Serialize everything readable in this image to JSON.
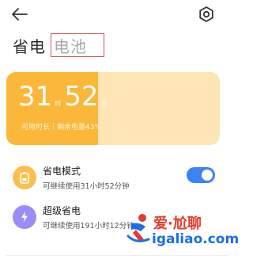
{
  "header": {
    "back_icon": "arrow-left-icon",
    "settings_icon": "gear-icon"
  },
  "title": {
    "page": "省电",
    "tab": "电池"
  },
  "battery": {
    "hours": "31",
    "hours_unit": "时",
    "minutes": "52",
    "minutes_unit": "分",
    "subtitle": "可用时长｜剩余电量43%",
    "level_percent": 43,
    "fill_color": "#fbb73a",
    "card_color": "#fde6b4"
  },
  "modes": [
    {
      "title": "省电模式",
      "desc": "可继续使用31小时52分钟",
      "icon": "battery-saver-icon",
      "toggle_on": true
    },
    {
      "title": "超级省电",
      "desc": "可继续使用191小时12分钟",
      "icon": "lightning-icon"
    }
  ],
  "watermark": {
    "text": "爱·尬聊",
    "url": "igaliao.com"
  }
}
